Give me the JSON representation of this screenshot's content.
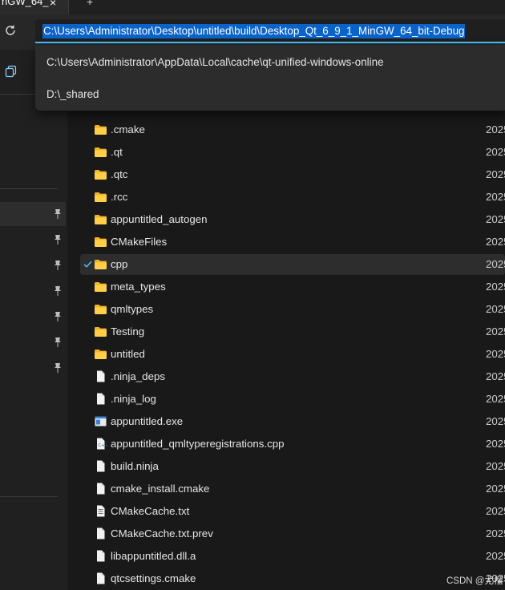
{
  "tab": {
    "title": "nGW_64_",
    "close_glyph": "×",
    "add_glyph": "+"
  },
  "toolbar": {
    "refresh_icon": "refresh-icon",
    "copy_icon": "copy-icon"
  },
  "address_bar": {
    "value": "C:\\Users\\Administrator\\Desktop\\untitled\\build\\Desktop_Qt_6_9_1_MinGW_64_bit-Debug"
  },
  "suggestions": [
    "C:\\Users\\Administrator\\AppData\\Local\\cache\\qt-unified-windows-online",
    "D:\\_shared"
  ],
  "files": [
    {
      "name": ".cmake",
      "type": "folder",
      "date": "2025"
    },
    {
      "name": ".qt",
      "type": "folder",
      "date": "2025"
    },
    {
      "name": ".qtc",
      "type": "folder",
      "date": "2025"
    },
    {
      "name": ".rcc",
      "type": "folder",
      "date": "2025"
    },
    {
      "name": "appuntitled_autogen",
      "type": "folder",
      "date": "2025"
    },
    {
      "name": "CMakeFiles",
      "type": "folder",
      "date": "2025"
    },
    {
      "name": "cpp",
      "type": "folder",
      "date": "2025",
      "selected": true
    },
    {
      "name": "meta_types",
      "type": "folder",
      "date": "2025"
    },
    {
      "name": "qmltypes",
      "type": "folder",
      "date": "2025"
    },
    {
      "name": "Testing",
      "type": "folder",
      "date": "2025"
    },
    {
      "name": "untitled",
      "type": "folder",
      "date": "2025"
    },
    {
      "name": ".ninja_deps",
      "type": "file",
      "date": "2025"
    },
    {
      "name": ".ninja_log",
      "type": "file",
      "date": "2025"
    },
    {
      "name": "appuntitled.exe",
      "type": "exe",
      "date": "2025"
    },
    {
      "name": "appuntitled_qmltyperegistrations.cpp",
      "type": "cpp",
      "date": "2025"
    },
    {
      "name": "build.ninja",
      "type": "file",
      "date": "2025"
    },
    {
      "name": "cmake_install.cmake",
      "type": "file",
      "date": "2025"
    },
    {
      "name": "CMakeCache.txt",
      "type": "text",
      "date": "2025"
    },
    {
      "name": "CMakeCache.txt.prev",
      "type": "file",
      "date": "2025"
    },
    {
      "name": "libappuntitled.dll.a",
      "type": "file",
      "date": "2025"
    },
    {
      "name": "qtcsettings.cmake",
      "type": "file",
      "date": "2025"
    }
  ],
  "watermark": "CSDN @尤榴",
  "colors": {
    "accent": "#4cc2ff",
    "selection": "#0a63c9",
    "folder": "#f5c242"
  }
}
